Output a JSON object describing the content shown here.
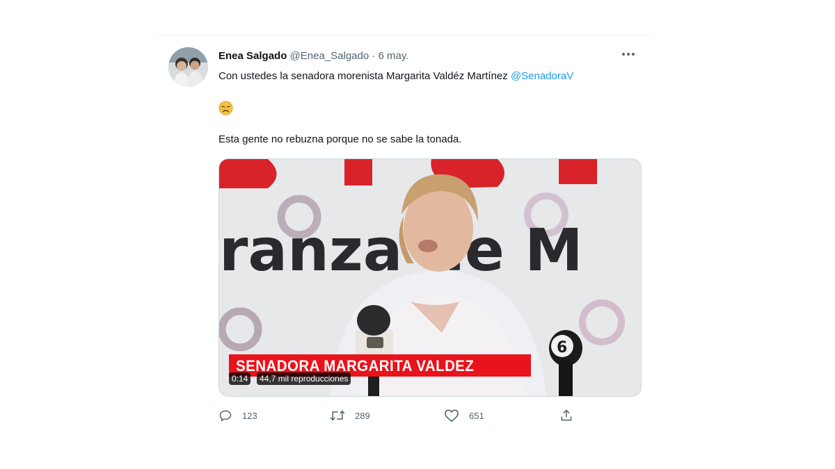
{
  "tweet": {
    "author_name": "Enea Salgado",
    "author_handle": "@Enea_Salgado",
    "separator": "·",
    "date": "6 may.",
    "text_line1": "Con ustedes la senadora morenista Margarita Valdéz Martínez",
    "mention": "@SenadoraV",
    "emoji": "disappointed-relieved-face-emoji",
    "text_line2": "Esta gente no rebuzna porque no se sabe la tonada."
  },
  "media": {
    "banner_text": "ranza de M",
    "lower_third": "SENADORA MARGARITA VALDEZ",
    "duration": "0:14",
    "views": "44,7 mil reproducciones",
    "channel_logo": "6"
  },
  "actions": {
    "replies": "123",
    "retweets": "289",
    "likes": "651"
  },
  "colors": {
    "accent": "#1d9bf0",
    "secondary_text": "#536471",
    "banner_red": "#e8131b"
  }
}
